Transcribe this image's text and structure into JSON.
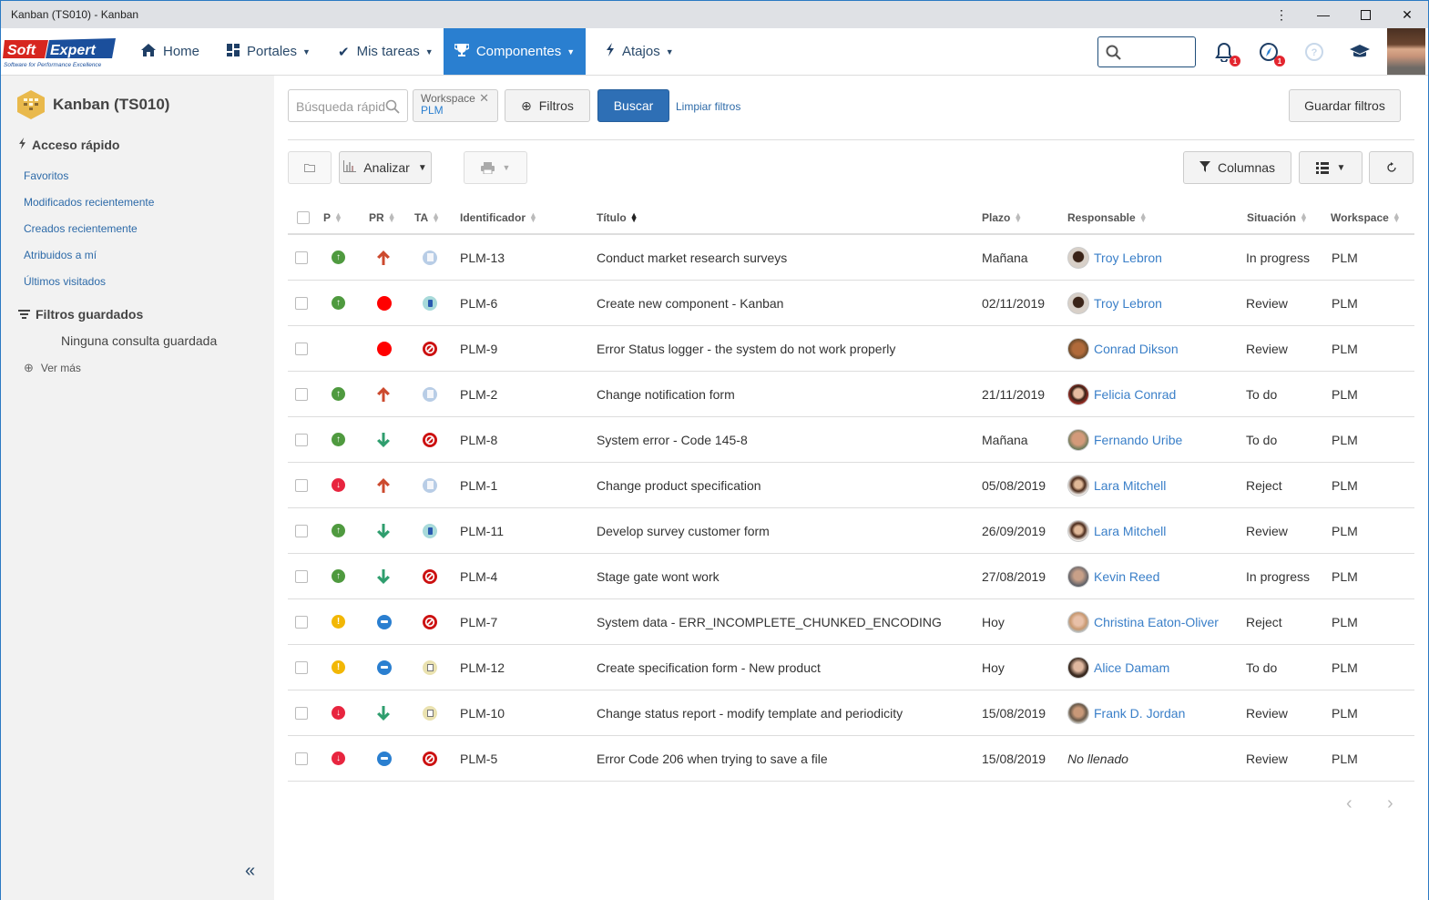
{
  "window": {
    "title": "Kanban (TS010) - Kanban",
    "controls": [
      "more-options",
      "minimize",
      "maximize",
      "close"
    ]
  },
  "navbar": {
    "logo_text": "Soft Expert",
    "logo_tagline": "Software for Performance Excellence",
    "items": [
      {
        "label": "Home",
        "icon": "home-icon",
        "dropdown": false,
        "active": false
      },
      {
        "label": "Portales",
        "icon": "grid-icon",
        "dropdown": true,
        "active": false
      },
      {
        "label": "Mis tareas",
        "icon": "check-icon",
        "dropdown": true,
        "active": false
      },
      {
        "label": "Componentes",
        "icon": "trophy-icon",
        "dropdown": true,
        "active": true
      },
      {
        "label": "Atajos",
        "icon": "bolt-icon",
        "dropdown": true,
        "active": false
      }
    ],
    "search_placeholder": "",
    "notifications_count": "1",
    "compass_count": "1",
    "accent": "#2a7fd0"
  },
  "sidebar": {
    "title": "Kanban (TS010)",
    "quick_access_label": "Acceso rápido",
    "quick_links": [
      "Favoritos",
      "Modificados recientemente",
      "Creados recientemente",
      "Atribuidos a mí",
      "Últimos visitados"
    ],
    "saved_filters_label": "Filtros guardados",
    "saved_filters_empty": "Ninguna consulta guardada",
    "see_more": "Ver más"
  },
  "filters": {
    "quick_search_placeholder": "Búsqueda rápida",
    "chip_key": "Workspace",
    "chip_value": "PLM",
    "filters_button": "Filtros",
    "search_button": "Buscar",
    "clear_filters": "Limpiar filtros",
    "save_filters": "Guardar filtros"
  },
  "toolbar": {
    "analyze": "Analizar",
    "columns": "Columnas"
  },
  "table": {
    "columns": {
      "p": "P",
      "pr": "PR",
      "ta": "TA",
      "id": "Identificador",
      "title": "Título",
      "deadline": "Plazo",
      "owner": "Responsable",
      "status": "Situación",
      "workspace": "Workspace"
    },
    "sorted_by": "Título",
    "rows": [
      {
        "p": "up",
        "pr": "arrow-up",
        "ta": "document",
        "id": "PLM-13",
        "title": "Conduct market research surveys",
        "deadline": "Mañana",
        "owner": "Troy Lebron",
        "status": "In progress",
        "workspace": "PLM"
      },
      {
        "p": "up",
        "pr": "red-dot",
        "ta": "megaphone",
        "id": "PLM-6",
        "title": "Create new component - Kanban",
        "deadline": "02/11/2019",
        "owner": "Troy Lebron",
        "status": "Review",
        "workspace": "PLM"
      },
      {
        "p": "none",
        "pr": "red-dot",
        "ta": "blocked",
        "id": "PLM-9",
        "title": "Error Status logger - the system do not work properly",
        "deadline": "",
        "owner": "Conrad Dikson",
        "status": "Review",
        "workspace": "PLM"
      },
      {
        "p": "up",
        "pr": "arrow-up",
        "ta": "document",
        "id": "PLM-2",
        "title": "Change notification form",
        "deadline": "21/11/2019",
        "owner": "Felicia Conrad",
        "status": "To do",
        "workspace": "PLM"
      },
      {
        "p": "up",
        "pr": "arrow-down",
        "ta": "blocked",
        "id": "PLM-8",
        "title": "System error - Code 145-8",
        "deadline": "Mañana",
        "owner": "Fernando Uribe",
        "status": "To do",
        "workspace": "PLM"
      },
      {
        "p": "down",
        "pr": "arrow-up",
        "ta": "document",
        "id": "PLM-1",
        "title": "Change product specification",
        "deadline": "05/08/2019",
        "owner": "Lara Mitchell",
        "status": "Reject",
        "workspace": "PLM"
      },
      {
        "p": "up",
        "pr": "arrow-down",
        "ta": "megaphone",
        "id": "PLM-11",
        "title": "Develop survey customer form",
        "deadline": "26/09/2019",
        "owner": "Lara Mitchell",
        "status": "Review",
        "workspace": "PLM"
      },
      {
        "p": "up",
        "pr": "arrow-down",
        "ta": "blocked",
        "id": "PLM-4",
        "title": "Stage gate wont work",
        "deadline": "27/08/2019",
        "owner": "Kevin Reed",
        "status": "In progress",
        "workspace": "PLM"
      },
      {
        "p": "warn",
        "pr": "minus",
        "ta": "blocked",
        "id": "PLM-7",
        "title": "System data - ERR_INCOMPLETE_CHUNKED_ENCODING",
        "deadline": "Hoy",
        "owner": "Christina Eaton-Oliver",
        "status": "Reject",
        "workspace": "PLM"
      },
      {
        "p": "warn",
        "pr": "minus",
        "ta": "clipboard",
        "id": "PLM-12",
        "title": "Create specification form - New product",
        "deadline": "Hoy",
        "owner": "Alice Damam",
        "status": "To do",
        "workspace": "PLM"
      },
      {
        "p": "down",
        "pr": "arrow-down",
        "ta": "clipboard",
        "id": "PLM-10",
        "title": "Change status report - modify template and periodicity",
        "deadline": "15/08/2019",
        "owner": "Frank D. Jordan",
        "status": "Review",
        "workspace": "PLM"
      },
      {
        "p": "down",
        "pr": "minus",
        "ta": "blocked",
        "id": "PLM-5",
        "title": "Error Code 206 when trying to save a file",
        "deadline": "15/08/2019",
        "owner": "No llenado",
        "status": "Review",
        "workspace": "PLM"
      }
    ]
  },
  "colors": {
    "priority_up": "#4f9a3f",
    "priority_down": "#e8253f",
    "priority_warn": "#f2b705",
    "arrow_up": "#cc4a2e",
    "arrow_down": "#2f9e6e",
    "red_dot": "#ff0000",
    "minus": "#2a7fd0",
    "blocked": "#cc1111",
    "link": "#3a7fc8"
  }
}
